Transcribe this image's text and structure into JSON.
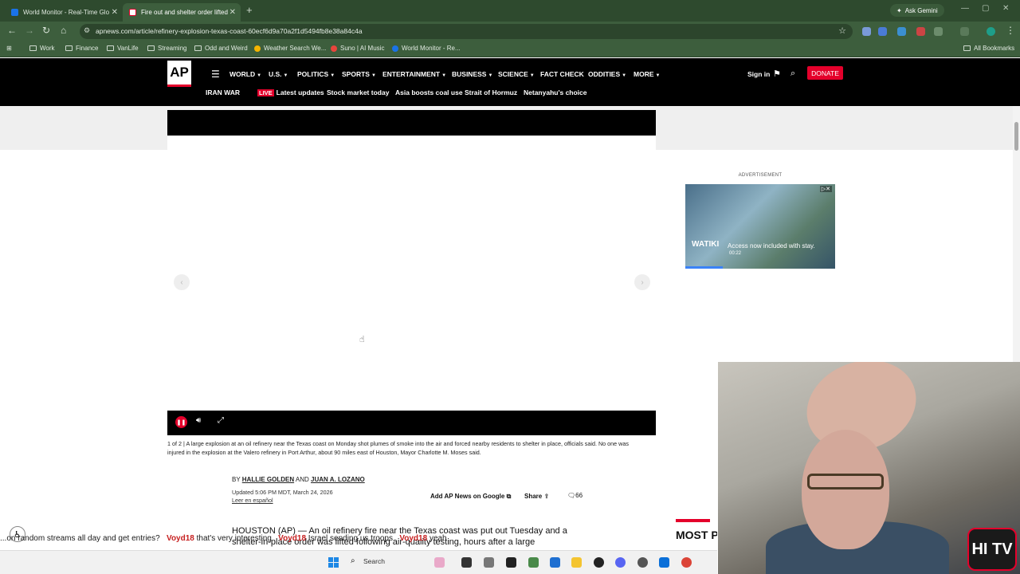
{
  "browser": {
    "tabs": [
      {
        "label": "World Monitor - Real-Time Glo",
        "active": false
      },
      {
        "label": "Fire out and shelter order lifted",
        "active": true
      }
    ],
    "ask_gemini": "Ask Gemini",
    "url": "apnews.com/article/refinery-explosion-texas-coast-60ecf6d9a70a2f1d5494fb8e38a84c4a",
    "bookmarks": [
      "Work",
      "Finance",
      "VanLife",
      "Streaming",
      "Odd and Weird",
      "Weather Search We...",
      "Suno | AI Music",
      "World Monitor - Re..."
    ],
    "all_bookmarks": "All Bookmarks"
  },
  "ap": {
    "logo": "AP",
    "nav": [
      "WORLD",
      "U.S.",
      "POLITICS",
      "SPORTS",
      "ENTERTAINMENT",
      "BUSINESS",
      "SCIENCE",
      "FACT CHECK",
      "ODDITIES",
      "MORE"
    ],
    "sign_in": "Sign in",
    "donate": "DONATE",
    "subnav_title": "IRAN WAR",
    "live_badge": "LIVE",
    "subnav": [
      "Latest updates",
      "Stock market today",
      "Asia boosts coal use",
      "Strait of Hormuz",
      "Netanyahu's choice"
    ]
  },
  "article": {
    "caption": "1 of 2 | A large explosion at an oil refinery near the Texas coast on Monday shot plumes of smoke into the air and forced nearby residents to shelter in place, officials said. No one was injured in the explosion at the Valero refinery in Port Arthur, about 90 miles east of Houston, Mayor Charlotte M. Moses said.",
    "by": "BY",
    "author1": "HALLIE GOLDEN",
    "and": "AND",
    "author2": "JUAN A. LOZANO",
    "updated": "Updated 5:06 PM MDT, March 24, 2026",
    "spanish": "Leer en español",
    "add_google": "Add AP News on Google",
    "share": "Share",
    "comments": "66",
    "lead": "HOUSTON (AP) — An oil refinery fire near the Texas coast was put out Tuesday and a shelter-in-place order was lifted following air-quality testing, hours after a large"
  },
  "ad": {
    "label": "ADVERTISEMENT",
    "brand": "WATIKI",
    "text": "Access now included with stay.",
    "time": "00:22",
    "progress": 0.25
  },
  "most_popular": "MOST POPULAR",
  "chat": [
    {
      "name": "",
      "text": "...on random streams all day and get entries?"
    },
    {
      "name": "Voyd18",
      "text": "that's very interesting"
    },
    {
      "name": "Voyd18",
      "text": "Israel sending us troops"
    },
    {
      "name": "Voyd18",
      "text": "yeah"
    }
  ],
  "taskbar": {
    "search": "Search"
  },
  "overlay_logo": "HI TV"
}
